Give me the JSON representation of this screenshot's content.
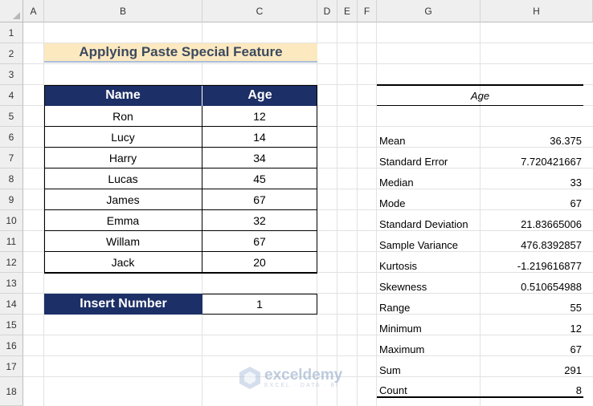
{
  "columns": [
    "A",
    "B",
    "C",
    "D",
    "E",
    "F",
    "G",
    "H"
  ],
  "rows": [
    "1",
    "2",
    "3",
    "4",
    "5",
    "6",
    "7",
    "8",
    "9",
    "10",
    "11",
    "12",
    "13",
    "14",
    "15",
    "16",
    "17",
    "18"
  ],
  "title": "Applying Paste Special Feature",
  "table": {
    "headers": [
      "Name",
      "Age"
    ],
    "rows": [
      [
        "Ron",
        "12"
      ],
      [
        "Lucy",
        "14"
      ],
      [
        "Harry",
        "34"
      ],
      [
        "Lucas",
        "45"
      ],
      [
        "James",
        "67"
      ],
      [
        "Emma",
        "32"
      ],
      [
        "Willam",
        "67"
      ],
      [
        "Jack",
        "20"
      ]
    ]
  },
  "insert": {
    "label": "Insert Number",
    "value": "1"
  },
  "stats": {
    "header": "Age",
    "items": [
      [
        "Mean",
        "36.375"
      ],
      [
        "Standard Error",
        "7.720421667"
      ],
      [
        "Median",
        "33"
      ],
      [
        "Mode",
        "67"
      ],
      [
        "Standard Deviation",
        "21.83665006"
      ],
      [
        "Sample Variance",
        "476.8392857"
      ],
      [
        "Kurtosis",
        "-1.219616877"
      ],
      [
        "Skewness",
        "0.510654988"
      ],
      [
        "Range",
        "55"
      ],
      [
        "Minimum",
        "12"
      ],
      [
        "Maximum",
        "67"
      ],
      [
        "Sum",
        "291"
      ],
      [
        "Count",
        "8"
      ]
    ]
  },
  "watermark": {
    "brand": "exceldemy",
    "tagline": "EXCEL · DATA · BI"
  }
}
